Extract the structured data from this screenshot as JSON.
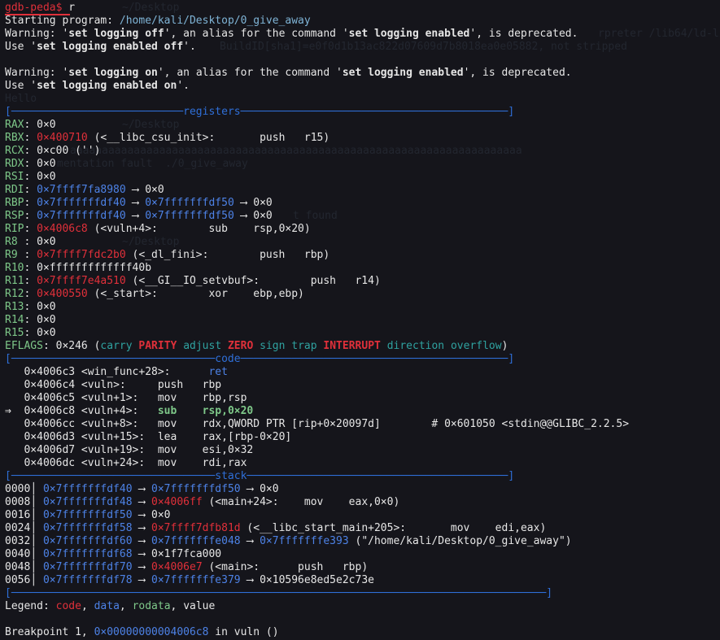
{
  "prompt": {
    "label": "gdb-peda$",
    "cmd": "r"
  },
  "start": {
    "label": "Starting program:",
    "path": "/home/kali/Desktop/0_give_away"
  },
  "warn1": {
    "a": "Warning: '",
    "b": "set logging off",
    "c": "', an alias for the command '",
    "d": "set logging enabled",
    "e": "', is deprecated."
  },
  "use1": {
    "a": "Use '",
    "b": "set logging enabled off",
    "c": "'."
  },
  "warn2": {
    "a": "Warning: '",
    "b": "set logging on",
    "c": "', an alias for the command '",
    "d": "set logging enabled",
    "e": "', is deprecated."
  },
  "use2": {
    "a": "Use '",
    "b": "set logging enabled on",
    "c": "'."
  },
  "sep_registers": {
    "left": "[",
    "fill1": "───────────────────────────",
    "label": "registers",
    "fill2": "──────────────────────────────────────────",
    "right": "]"
  },
  "registers": [
    {
      "name": "RAX",
      "sep": ": ",
      "val": "0×0",
      "valc": "",
      "rest": ""
    },
    {
      "name": "RBX",
      "sep": ": ",
      "val": "0×400710",
      "valc": "red",
      "rest": " (<__libc_csu_init>:       push   r15)"
    },
    {
      "name": "RCX",
      "sep": ": ",
      "val": "0×c00 ('')",
      "valc": "",
      "rest": ""
    },
    {
      "name": "RDX",
      "sep": ": ",
      "val": "0×0",
      "valc": "",
      "rest": ""
    },
    {
      "name": "RSI",
      "sep": ": ",
      "val": "0×0",
      "valc": "",
      "rest": ""
    },
    {
      "name": "RDI",
      "sep": ": ",
      "val": "0×7ffff7fa8980",
      "valc": "blue",
      "rest": " ⟶ 0×0"
    },
    {
      "name": "RBP",
      "sep": ": ",
      "val": "0×7fffffffdf40",
      "valc": "blue",
      "rest": " ⟶ ",
      "v2": "0×7fffffffdf50",
      "rest2": " ⟶ 0×0"
    },
    {
      "name": "RSP",
      "sep": ": ",
      "val": "0×7fffffffdf40",
      "valc": "blue",
      "rest": " ⟶ ",
      "v2": "0×7fffffffdf50",
      "rest2": " ⟶ 0×0"
    },
    {
      "name": "RIP",
      "sep": ": ",
      "val": "0×4006c8",
      "valc": "red",
      "rest": " (<vuln+4>:        sub    rsp,0×20)"
    },
    {
      "name": "R8 ",
      "sep": ": ",
      "val": "0×0",
      "valc": "",
      "rest": ""
    },
    {
      "name": "R9 ",
      "sep": ": ",
      "val": "0×7ffff7fdc2b0",
      "valc": "red",
      "rest": " (<_dl_fini>:        push   rbp)"
    },
    {
      "name": "R10",
      "sep": ": ",
      "val": "0×fffffffffffff40b",
      "valc": "",
      "rest": ""
    },
    {
      "name": "R11",
      "sep": ": ",
      "val": "0×7ffff7e4a510",
      "valc": "red",
      "rest": " (<__GI__IO_setvbuf>:        push   r14)"
    },
    {
      "name": "R12",
      "sep": ": ",
      "val": "0×400550",
      "valc": "red",
      "rest": " (<_start>:        xor    ebp,ebp)"
    },
    {
      "name": "R13",
      "sep": ": ",
      "val": "0×0",
      "valc": "",
      "rest": ""
    },
    {
      "name": "R14",
      "sep": ": ",
      "val": "0×0",
      "valc": "",
      "rest": ""
    },
    {
      "name": "R15",
      "sep": ": ",
      "val": "0×0",
      "valc": "",
      "rest": ""
    }
  ],
  "eflags": {
    "label": "EFLAGS",
    "val": ": 0×246 (",
    "f1": "carry",
    "f2": "PARITY",
    "f3": "adjust",
    "f4": "ZERO",
    "f5": "sign",
    "f6": "trap",
    "f7": "INTERRUPT",
    "f8": "direction",
    "f9": "overflow",
    "end": ")"
  },
  "sep_code": {
    "left": "[",
    "fill1": "────────────────────────────────",
    "label": "code",
    "fill2": "──────────────────────────────────────────",
    "right": "]"
  },
  "code": [
    {
      "arrow": "   ",
      "addr": "0×4006c3",
      "sym": " <win_func+28>:     ",
      "op": " ret",
      "args": "",
      "current": false,
      "retline": true
    },
    {
      "arrow": "   ",
      "addr": "0×4006c4",
      "sym": " <vuln>:     ",
      "op": "push",
      "args": "   rbp",
      "current": false
    },
    {
      "arrow": "   ",
      "addr": "0×4006c5",
      "sym": " <vuln+1>:   ",
      "op": "mov",
      "args": "    rbp,rsp",
      "current": false
    },
    {
      "arrow": "⇒  ",
      "addr": "0×4006c8",
      "sym": " <vuln+4>:   ",
      "op": "sub",
      "args": "    rsp,0×20",
      "current": true
    },
    {
      "arrow": "   ",
      "addr": "0×4006cc",
      "sym": " <vuln+8>:   ",
      "op": "mov",
      "args": "    rdx,QWORD PTR [rip+0×20097d]        # 0×601050 <stdin@@GLIBC_2.2.5>",
      "current": false
    },
    {
      "arrow": "   ",
      "addr": "0×4006d3",
      "sym": " <vuln+15>:  ",
      "op": "lea",
      "args": "    rax,[rbp-0×20]",
      "current": false
    },
    {
      "arrow": "   ",
      "addr": "0×4006d7",
      "sym": " <vuln+19>:  ",
      "op": "mov",
      "args": "    esi,0×32",
      "current": false
    },
    {
      "arrow": "   ",
      "addr": "0×4006dc",
      "sym": " <vuln+24>:  ",
      "op": "mov",
      "args": "    rdi,rax",
      "current": false
    }
  ],
  "sep_stack": {
    "left": "[",
    "fill1": "────────────────────────────────",
    "label": "stack",
    "fill2": "─────────────────────────────────────────",
    "right": "]"
  },
  "stack": [
    {
      "off": "0000",
      "addr": "0×7fffffffdf40",
      "a1": " ⟶ ",
      "v1": "0×7fffffffdf50",
      "v1c": "blue",
      "a2": " ⟶ 0×0",
      "v2": "",
      "tail": ""
    },
    {
      "off": "0008",
      "addr": "0×7fffffffdf48",
      "a1": " ⟶ ",
      "v1": "0×4006ff",
      "v1c": "red",
      "a2": " (<main+24>:    mov    eax,0×0)",
      "v2": "",
      "tail": ""
    },
    {
      "off": "0016",
      "addr": "0×7fffffffdf50",
      "a1": " ⟶ 0×0",
      "v1": "",
      "v1c": "",
      "a2": "",
      "v2": "",
      "tail": ""
    },
    {
      "off": "0024",
      "addr": "0×7fffffffdf58",
      "a1": " ⟶ ",
      "v1": "0×7ffff7dfb81d",
      "v1c": "red",
      "a2": " (<__libc_start_main+205>:       mov    edi,eax)",
      "v2": "",
      "tail": ""
    },
    {
      "off": "0032",
      "addr": "0×7fffffffdf60",
      "a1": " ⟶ ",
      "v1": "0×7fffffffe048",
      "v1c": "blue",
      "a2": " ⟶ ",
      "v2": "0×7fffffffe393",
      "tail": " (\"/home/kali/Desktop/0_give_away\")"
    },
    {
      "off": "0040",
      "addr": "0×7fffffffdf68",
      "a1": " ⟶ 0×1f7fca000",
      "v1": "",
      "v1c": "",
      "a2": "",
      "v2": "",
      "tail": ""
    },
    {
      "off": "0048",
      "addr": "0×7fffffffdf70",
      "a1": " ⟶ ",
      "v1": "0×4006e7",
      "v1c": "red",
      "a2": " (<main>:      push   rbp)",
      "v2": "",
      "tail": ""
    },
    {
      "off": "0056",
      "addr": "0×7fffffffdf78",
      "a1": " ⟶ ",
      "v1": "0×7fffffffe379",
      "v1c": "blue",
      "a2": " ⟶ 0×10596e8ed5e2c73e",
      "v2": "",
      "tail": ""
    }
  ],
  "sep_end": {
    "left": "[",
    "fill": "────────────────────────────────────────────────────────────────────────────────────",
    "right": "]"
  },
  "legend": {
    "label": "Legend: ",
    "code": "code",
    "data": "data",
    "rodata": "rodata",
    "value": "value"
  },
  "breakpoint": {
    "a": "Breakpoint 1, ",
    "addr": "0×00000000004006c8",
    "b": " in ",
    "fn": "vuln",
    "c": " ()"
  },
  "ghost": {
    "g1": "~/Desktop",
    "g2": "rpreter /lib64/ld-li",
    "g3": "BuildID[sha1]=e0f0d1b13ac822d07609d7b8018ea0e05882, not stripped",
    "g4": "Hello",
    "g5": "~/Desktop",
    "g6": "aaaaaaaaaaaaaaaaaaaaaaaaaaaaaaaaaaaaaaaaaaaaaaaaaaaaaaaaaaaaaaaaaaaaaaa",
    "g7": "mentation fault  ./0_give_away",
    "g8": "~/Desktop",
    "g9": "t found",
    "g10": "~/Desktop"
  },
  "colors": {
    "background": "#15151b",
    "red": "#e0303a",
    "blue": "#4d82e6",
    "green": "#7ec889",
    "separator": "#2f6fd8"
  }
}
